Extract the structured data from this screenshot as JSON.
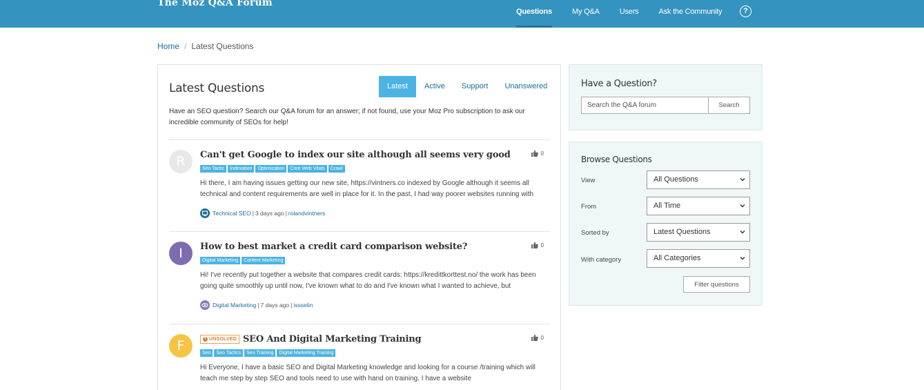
{
  "header": {
    "title": "The Moz Q&A Forum",
    "nav": [
      {
        "label": "Questions",
        "active": true
      },
      {
        "label": "My Q&A",
        "active": false
      },
      {
        "label": "Users",
        "active": false
      },
      {
        "label": "Ask the Community",
        "active": false
      }
    ],
    "help_label": "?"
  },
  "breadcrumb": {
    "home": "Home",
    "separator": "/",
    "current": "Latest Questions"
  },
  "main": {
    "title": "Latest Questions",
    "tabs": [
      {
        "label": "Latest",
        "active": true
      },
      {
        "label": "Active",
        "active": false
      },
      {
        "label": "Support",
        "active": false
      },
      {
        "label": "Unanswered",
        "active": false
      }
    ],
    "intro": "Have an SEO question? Search our Q&A forum for an answer; if not found, use your Moz Pro subscription to ask our incredible community of SEOs for help!",
    "questions": [
      {
        "avatar_letter": "R",
        "avatar_color": "#e6e6e6",
        "unsolved": "",
        "title": "Can't get Google to index our site although all seems very good",
        "tags": [
          "Seo Tactic",
          "Indexation",
          "Optimization",
          "Core Web Vitals",
          "Crawl"
        ],
        "body": "Hi there, I am having issues getting our new site, https://vintners.co indexed by Google although it seems all technical and content requirements are well in place for it. In the past, I had way poorer websites running with",
        "category": "Technical SEO",
        "category_color": "#1a6c9c",
        "category_icon": "monitor-icon",
        "time": "3 days ago",
        "user": "rolandvintners",
        "votes": "0"
      },
      {
        "avatar_letter": "I",
        "avatar_color": "#7f6cb0",
        "unsolved": "",
        "title": "How to best market a credit card comparison website?",
        "tags": [
          "Digital Marketing",
          "Content Marketing"
        ],
        "body": "Hi! I've recently put together a website that compares credit cards: https://kredittkorttest.no/ the work has been going quite smoothly up until now, I've known what to do and I've known what I wanted to achieve, but",
        "category": "Digital Marketing",
        "category_color": "#8c79bd",
        "category_icon": "eye-icon",
        "time": "7 days ago",
        "user": "issselin",
        "votes": "0"
      },
      {
        "avatar_letter": "F",
        "avatar_color": "#f5c445",
        "unsolved": "UNSOLVED",
        "title": "SEO And Digital Marketing Training",
        "tags": [
          "Seo",
          "Seo Tactics",
          "Seo Training",
          "Digital Marketing Training"
        ],
        "body": "Hi Everyone, I have a basic SEO and Digital Marketing knowledge and looking for a course /training which will teach me step by step SEO and tools need to use with hand on training. I have a website",
        "category": "",
        "category_color": "#1a6c9c",
        "category_icon": "",
        "time": "",
        "user": "",
        "votes": "0"
      }
    ]
  },
  "sidebar": {
    "ask": {
      "title": "Have a Question?",
      "search_placeholder": "Search the Q&A forum",
      "search_button": "Search"
    },
    "browse": {
      "title": "Browse Questions",
      "filters": [
        {
          "label": "View",
          "value": "All Questions"
        },
        {
          "label": "From",
          "value": "All Time"
        },
        {
          "label": "Sorted by",
          "value": "Latest Questions"
        },
        {
          "label": "With category",
          "value": "All Categories"
        }
      ],
      "filter_button": "Filter questions"
    }
  },
  "colors": {
    "header_bg": "#3593bf",
    "accent": "#4cb3e2",
    "link": "#1a6c9c",
    "sidebar_bg": "#f0f7f7"
  }
}
